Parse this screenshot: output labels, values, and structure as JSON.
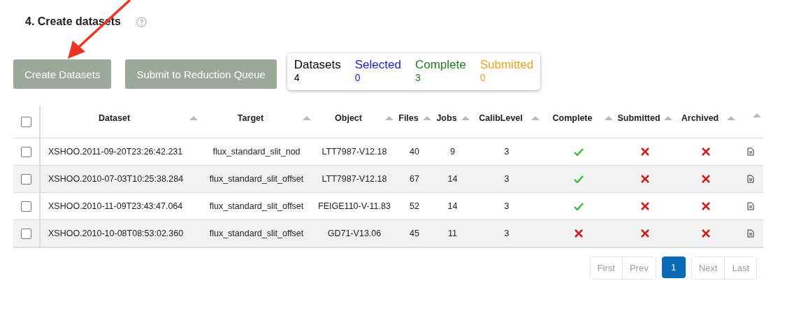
{
  "heading": "4. Create datasets",
  "buttons": [
    {
      "label": "Create Datasets"
    },
    {
      "label": "Submit to Reduction Queue"
    }
  ],
  "summary": [
    {
      "label": "Datasets",
      "value": "4",
      "color": "#000000"
    },
    {
      "label": "Selected",
      "value": "0",
      "color": "#1a1ad6"
    },
    {
      "label": "Complete",
      "value": "3",
      "color": "#1f7a1f"
    },
    {
      "label": "Submitted",
      "value": "0",
      "color": "#f0a020"
    }
  ],
  "table": {
    "all_selected": false,
    "columns": [
      "Dataset",
      "Target",
      "Object",
      "Files",
      "Jobs",
      "CalibLevel",
      "Complete",
      "Submitted",
      "Archived"
    ],
    "rows": [
      {
        "selected": false,
        "dataset": "XSHOO.2011-09-20T23:26:42.231",
        "target": "flux_standard_slit_nod",
        "object": "LTT7987-V12.18",
        "files": "40",
        "jobs": "9",
        "calib_level": "3",
        "complete": true,
        "submitted": false,
        "archived": false
      },
      {
        "selected": false,
        "dataset": "XSHOO.2010-07-03T10:25:38.284",
        "target": "flux_standard_slit_offset",
        "object": "LTT7987-V12.18",
        "files": "67",
        "jobs": "14",
        "calib_level": "3",
        "complete": true,
        "submitted": false,
        "archived": false
      },
      {
        "selected": false,
        "dataset": "XSHOO.2010-11-09T23:43:47.064",
        "target": "flux_standard_slit_offset",
        "object": "FEIGE110-V-11.83",
        "files": "52",
        "jobs": "14",
        "calib_level": "3",
        "complete": true,
        "submitted": false,
        "archived": false
      },
      {
        "selected": false,
        "dataset": "XSHOO.2010-10-08T08:53:02.360",
        "target": "flux_standard_slit_offset",
        "object": "GD71-V13.06",
        "files": "45",
        "jobs": "11",
        "calib_level": "3",
        "complete": false,
        "submitted": false,
        "archived": false
      }
    ]
  },
  "pagination": [
    {
      "label": "First",
      "selected": false,
      "disabled": true
    },
    {
      "label": "Prev",
      "selected": false,
      "disabled": true
    },
    {
      "label": "1",
      "selected": true,
      "disabled": false
    },
    {
      "label": "Next",
      "selected": false,
      "disabled": true
    },
    {
      "label": "Last",
      "selected": false,
      "disabled": true
    }
  ]
}
